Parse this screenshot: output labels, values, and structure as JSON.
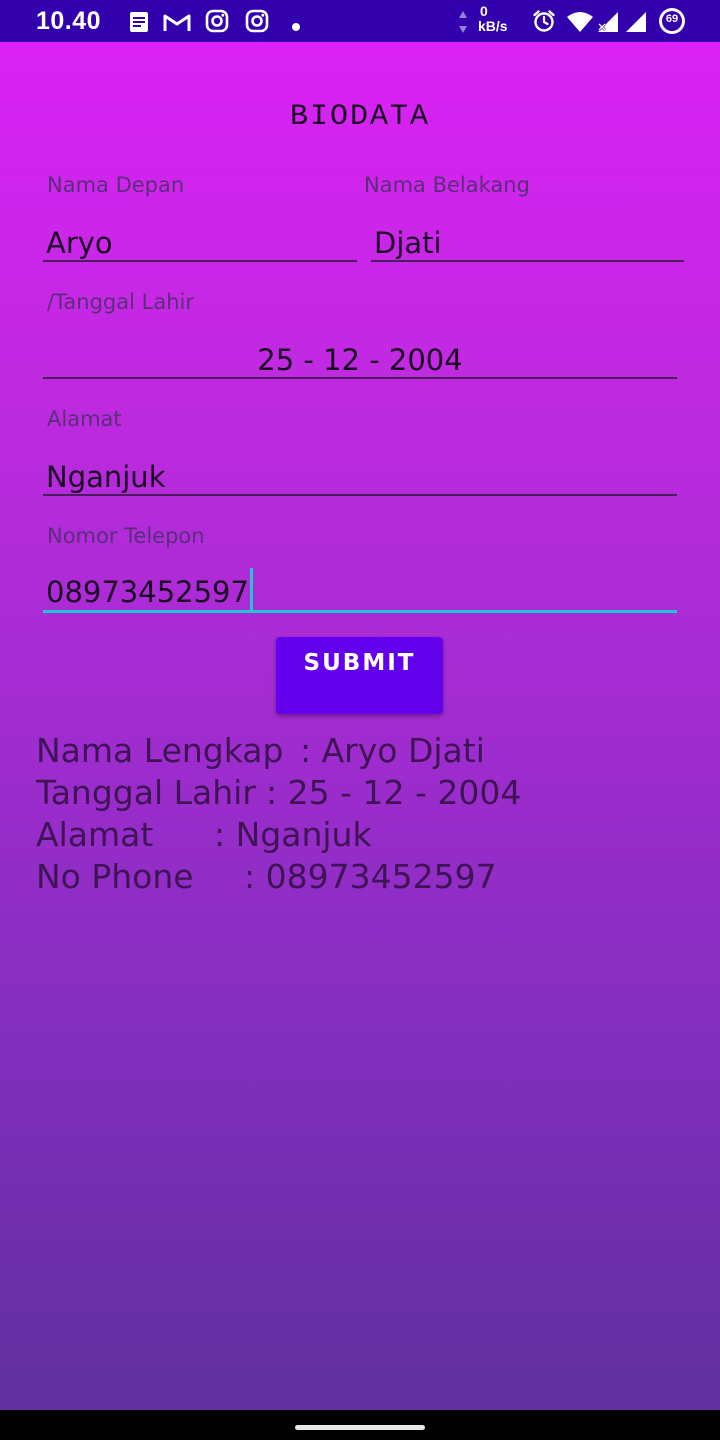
{
  "status_bar": {
    "time": "10.40",
    "speed_value": "0",
    "speed_unit": "kB/s",
    "battery": "69",
    "icons": [
      "notes-icon",
      "gmail-icon",
      "instagram-icon",
      "instagram-icon",
      "dot-icon",
      "data-arrows-icon",
      "alarm-icon",
      "wifi-icon",
      "signal-icon",
      "battery-icon"
    ]
  },
  "form": {
    "title": "BIODATA",
    "first_name": {
      "label": "Nama Depan",
      "value": "Aryo"
    },
    "last_name": {
      "label": "Nama Belakang",
      "value": "Djati"
    },
    "birth_date": {
      "label": "/Tanggal Lahir",
      "value": "25 - 12 - 2004"
    },
    "address": {
      "label": "Alamat",
      "value": "Nganjuk"
    },
    "phone": {
      "label": "Nomor Telepon",
      "value": "08973452597"
    },
    "submit_label": "SUBMIT"
  },
  "result": {
    "rows": [
      {
        "label": "Nama Lengkap",
        "value": ": Aryo Djati"
      },
      {
        "label": "Tanggal Lahir",
        "value": ": 25 - 12 - 2004"
      },
      {
        "label": "Alamat",
        "value": ": Nganjuk"
      },
      {
        "label": "No Phone",
        "value": ": 08973452597"
      }
    ]
  },
  "colors": {
    "status_bar": "#3200ad",
    "gradient_top": "#db21f6",
    "gradient_bottom": "#60309e",
    "button": "#6200ee",
    "focus_accent": "#1ec6d6"
  }
}
